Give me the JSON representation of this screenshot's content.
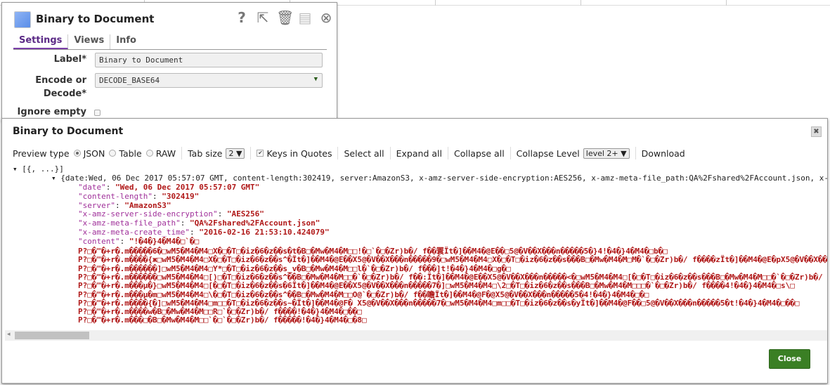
{
  "settings_panel": {
    "title": "Binary to Document",
    "icons": [
      "help-icon",
      "export-icon",
      "trash-icon",
      "save-icon",
      "close-circle-icon"
    ],
    "tabs": [
      "Settings",
      "Views",
      "Info"
    ],
    "label_field": {
      "label": "Label*",
      "value": "Binary to Document"
    },
    "encode_field": {
      "label1": "Encode or",
      "label2": "Decode*",
      "value": "DECODE_BASE64"
    },
    "ignore_empty": {
      "label": "Ignore empty",
      "checked": false
    }
  },
  "dialog": {
    "title": "Binary to Document",
    "toolbar": {
      "preview_type": "Preview type",
      "json": "JSON",
      "table": "Table",
      "raw": "RAW",
      "selected": "JSON",
      "tab_size_label": "Tab size",
      "tab_size": "2",
      "keys_in_quotes": "Keys in Quotes",
      "keys_checked": true,
      "select_all": "Select all",
      "expand_all": "Expand all",
      "collapse_all": "Collapse all",
      "collapse_level_label": "Collapse Level",
      "collapse_level": "level 2+",
      "download": "Download"
    },
    "tree": {
      "root": "[{, ...}]",
      "obj": "{date:Wed, 06 Dec 2017 05:57:07 GMT, content-length:302419, server:AmazonS3, x-amz-server-side-encryption:AES256, x-amz-meta-file_path:QA%2Fshared%2FAccount.json, x-a",
      "fields": [
        {
          "key": "\"date\"",
          "value": "\"Wed, 06 Dec 2017 05:57:07 GMT\""
        },
        {
          "key": "\"content-length\"",
          "value": "\"302419\""
        },
        {
          "key": "\"server\"",
          "value": "\"AmazonS3\""
        },
        {
          "key": "\"x-amz-server-side-encryption\"",
          "value": "\"AES256\""
        },
        {
          "key": "\"x-amz-meta-file_path\"",
          "value": "\"QA%2Fshared%2FAccount.json\""
        },
        {
          "key": "\"x-amz-meta-create_time\"",
          "value": "\"2016-02-16 21:53:10.424079\""
        },
        {
          "key": "\"content\"",
          "value": "\"!�4�}4�M4�□`�□"
        }
      ],
      "content_lines": [
        "P?□�\"�+r�.m�����6�□wM5�M4�M4□X�□�T□�iz�6�z��s�t�B□�Mw�M4�M□□!�□`�□�Zr)b�/ f��瞏Ït�]��M4�@E��□5@�V��X���n�����5�}4!�4�}4�M4�□b�□",
        "P?□�\"�+r�.m����{ж□wM5�M4�M4□X�□�T□�iz�6�z��s^�Ït�]��M4�@E��X5@�V��X���n�����9�□wM5�M4�M4□X�□�T□�iz�6�z��s���B□�Mw�M4�M□M�`�□�Zr)b�/ f����zÏt�]��M4�@E�pX5@�V��X���",
        "P?□�\"�+r�.m������]□wM5�M4�M4□Y*□�T□�iz�6�z��s_v�B□�Mw�M4�M□□l�`�□�Zr)b�/ f���]t!�4�}4�M4�□g�□",
        "P?□�\"�+r�.m������□wM5�M4�M4□[)□�T□�iz�6�z��s^��B□�Mw�M4�M□□�`�□�Zr)b�/ f��:Ït�]��M4�@E��X5@�V��X���n�����<�□wM5�M4�M4□[�□�T□�iz�6�z��s���B□�Mw�M4�M□□�`�□�Zr)b�/ f",
        "P?□�\"�+r�.m���μ�}□wM5�M4�M4□[�□�T□�iz�6�z��s�6Ït�]��M4�@E��X5@�V��X���n�����7�]□wM5�M4�M4□\\2□�T□�iz�6�z��s���B□�Mw�M4�M□□□�`�□�Zr)b�/ f����4!�4�}4�M4�□s\\□",
        "P?□�\"�+r�.m���μ�m□wM5�M4�M4□\\�□�T□�iz�6�z��s^��B□�Mw�M4�M□□O@`�□�Zr)b�/ f��瞻Ït�]��M4�@F�@X5@�V��X���n�����5�4!�4�}4�M4�□�□",
        "P?□�\"�+r�.m����{�]□wM5�M4�M4□m□□�T□�iz�6�z��s~�Ït�]��M4�@F� X5@�V��X���n�����7�□wM5�M4�M4□m□□�T□�iz�6�z��s�yÏt�]��M4�@F��□5@�V��X���n�����5�t!�4�}4�M4�□��□",
        "P?□�\"�+r�.m����w�B□�Mw�M4�M□□R□`�□�Zr)b�/ f����!�4�}4�M4�□��□",
        "P?□�\"�+r�.m���□�B□�Mw�M4�M□□`�□`�□�Zr)b�/ f�����!�4�}4�M4�□�8□"
      ]
    },
    "close_label": "Close"
  }
}
